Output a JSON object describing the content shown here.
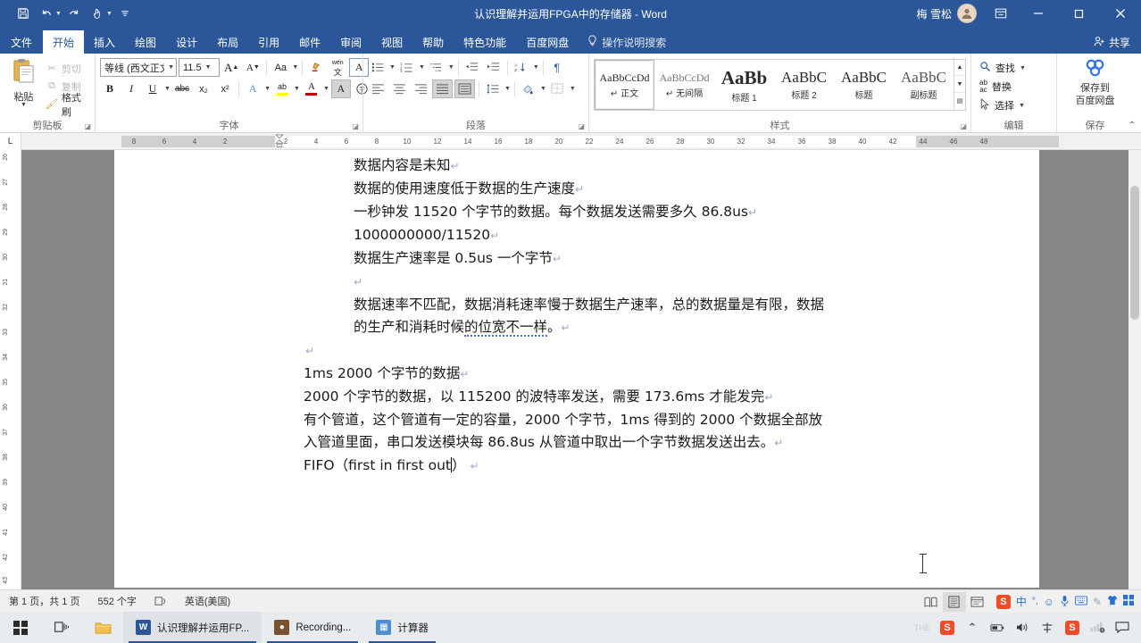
{
  "titlebar": {
    "document_title": "认识理解并运用FPGA中的存储器  -  Word",
    "quick_access": [
      {
        "name": "save",
        "glyph": "ὋE"
      },
      {
        "name": "undo",
        "glyph": "↶"
      },
      {
        "name": "redo",
        "glyph": "↻"
      },
      {
        "name": "touch-mode",
        "glyph": "✋"
      },
      {
        "name": "customize",
        "glyph": "≡"
      }
    ],
    "account_name": "梅 雪松",
    "avatar_glyph": "☺",
    "ribbon_display_options": "❐",
    "minimize": "—",
    "restore": "❐",
    "close": "✕"
  },
  "tabs": [
    {
      "label": "文件",
      "active": false
    },
    {
      "label": "开始",
      "active": true
    },
    {
      "label": "插入",
      "active": false
    },
    {
      "label": "绘图",
      "active": false
    },
    {
      "label": "设计",
      "active": false
    },
    {
      "label": "布局",
      "active": false
    },
    {
      "label": "引用",
      "active": false
    },
    {
      "label": "邮件",
      "active": false
    },
    {
      "label": "审阅",
      "active": false
    },
    {
      "label": "视图",
      "active": false
    },
    {
      "label": "帮助",
      "active": false
    },
    {
      "label": "特色功能",
      "active": false
    },
    {
      "label": "百度网盘",
      "active": false
    }
  ],
  "tell_me": "操作说明搜索",
  "share_label": "共享",
  "ribbon": {
    "clipboard": {
      "group_label": "剪贴板",
      "paste_label": "粘贴",
      "cut_label": "剪切",
      "copy_label": "复制",
      "format_painter_label": "格式刷"
    },
    "font": {
      "group_label": "字体",
      "font_name": "等线 (西文正文",
      "font_size": "11.5",
      "grow_font": "A",
      "shrink_font": "A",
      "change_case": "Aa",
      "clear_formatting": "✂",
      "phonetic_guide": "文",
      "character_border": "A",
      "bold": "B",
      "italic": "I",
      "underline": "U",
      "strikethrough": "abc",
      "subscript": "x₂",
      "superscript": "x²",
      "text_effects": "A",
      "highlight": "ab",
      "font_color": "A",
      "char_shading": "A",
      "enclose_char": "字"
    },
    "paragraph": {
      "group_label": "段落",
      "bullets": "☰",
      "numbering": "☰",
      "multilevel": "☰",
      "decrease_indent": "←",
      "increase_indent": "→",
      "sort": "AZ",
      "show_marks": "¶",
      "align_left": "≡",
      "align_center": "≡",
      "align_right": "≡",
      "justify": "≡",
      "distributed": "≡",
      "line_spacing": "↕",
      "shading": "■",
      "borders": "▦"
    },
    "styles": {
      "group_label": "样式",
      "items": [
        {
          "preview": "AaBbCcDd",
          "name": "正文",
          "selected": true,
          "kind": "normal"
        },
        {
          "preview": "AaBbCcDd",
          "name": "无间隔",
          "selected": false,
          "kind": "normal"
        },
        {
          "preview": "AaBb",
          "name": "标题 1",
          "selected": false,
          "kind": "h1"
        },
        {
          "preview": "AaBbC",
          "name": "标题 2",
          "selected": false,
          "kind": "h2"
        },
        {
          "preview": "AaBbC",
          "name": "标题",
          "selected": false,
          "kind": "t"
        },
        {
          "preview": "AaBbC",
          "name": "副标题",
          "selected": false,
          "kind": "st"
        }
      ]
    },
    "editing": {
      "group_label": "编辑",
      "find_label": "查找",
      "replace_label": "替换",
      "select_label": "选择"
    },
    "save_group": {
      "group_label": "保存",
      "baidu_label_line1": "保存到",
      "baidu_label_line2": "百度网盘"
    }
  },
  "ruler": {
    "tab_selector": "L",
    "h_marks": [
      "8",
      "6",
      "4",
      "2",
      "",
      "2",
      "4",
      "6",
      "8",
      "10",
      "12",
      "14",
      "16",
      "18",
      "20",
      "22",
      "24",
      "26",
      "28",
      "30",
      "32",
      "34",
      "36",
      "38",
      "40",
      "42",
      "44",
      "46",
      "48"
    ],
    "v_marks": [
      "26",
      "27",
      "28",
      "29",
      "30",
      "31",
      "32",
      "33",
      "34",
      "35",
      "36",
      "37",
      "38",
      "39",
      "40",
      "41",
      "42",
      "43"
    ]
  },
  "document": {
    "lines": [
      {
        "text": "数据内容是未知",
        "indent": true,
        "pilcrow": true
      },
      {
        "text": "数据的使用速度低于数据的生产速度",
        "indent": true,
        "pilcrow": true
      },
      {
        "text": "一秒钟发 11520 个字节的数据。每个数据发送需要多久 86.8us",
        "indent": true,
        "pilcrow": true
      },
      {
        "text": "1000000000/11520",
        "indent": true,
        "pilcrow": true
      },
      {
        "text": "数据生产速率是 0.5us 一个字节",
        "indent": true,
        "pilcrow": true
      },
      {
        "text": "",
        "indent": true,
        "pilcrow": true
      },
      {
        "text": "数据速率不匹配，数据消耗速率慢于数据生产速率，总的数据量是有限，数据",
        "indent": true,
        "pilcrow": false
      },
      {
        "text": "的生产和消耗时候的位宽不一样。",
        "indent": true,
        "pilcrow": true,
        "squiggle_from": "的位宽不一样"
      },
      {
        "text": "",
        "indent": false,
        "pilcrow": true
      },
      {
        "text": "1ms 2000 个字节的数据",
        "indent": false,
        "pilcrow": true
      },
      {
        "text": "2000 个字节的数据，以 115200 的波特率发送，需要 173.6ms 才能发完",
        "indent": false,
        "pilcrow": true
      },
      {
        "text": "有个管道，这个管道有一定的容量，2000 个字节，1ms 得到的 2000 个数据全部放",
        "indent": false,
        "pilcrow": false
      },
      {
        "text": "入管道里面，串口发送模块每 86.8us 从管道中取出一个字节数据发送出去。",
        "indent": false,
        "pilcrow": true
      },
      {
        "text": "FIFO（first in first out）",
        "indent": false,
        "pilcrow": true,
        "caret_after": "FIFO（first in first out"
      }
    ]
  },
  "statusbar": {
    "page_info": "第 1 页，共 1 页",
    "word_count": "552 个字",
    "proofing_icon": "✓",
    "language": "英语(美国)",
    "views": [
      {
        "name": "read-mode",
        "glyph": "Ὅ6",
        "active": false
      },
      {
        "name": "print-layout",
        "glyph": "▤",
        "active": true
      },
      {
        "name": "web-layout",
        "glyph": "▦",
        "active": false
      }
    ],
    "ime": {
      "logo": "S",
      "mode": "中",
      "punctuation": "°,",
      "emoji": "☺",
      "voice": "Ἲ4",
      "keyboard": "⌨",
      "handwriting": "✍",
      "skin": "ὅ5",
      "toolbox": "⊞"
    }
  },
  "taskbar": {
    "start": "⊞",
    "task_view": "❑",
    "file_explorer": "Ὄ1",
    "items": [
      {
        "label": "认识理解并运用FP...",
        "icon": "W",
        "icon_kind": "ico-word",
        "active": true
      },
      {
        "label": "Recording...",
        "icon": "R",
        "icon_kind": "ico-rec",
        "active": false
      },
      {
        "label": "计算器",
        "icon": "▦",
        "icon_kind": "ico-calc",
        "active": false
      }
    ],
    "tray": [
      {
        "name": "sogou-pinyin-tray",
        "glyph": "S"
      },
      {
        "name": "show-hidden-icons",
        "glyph": "⌃"
      },
      {
        "name": "battery",
        "glyph": "ὐB"
      },
      {
        "name": "volume",
        "glyph": "ὐA"
      },
      {
        "name": "ime-indicator",
        "glyph": "中"
      },
      {
        "name": "sogou-input",
        "glyph": "S"
      },
      {
        "name": "network",
        "glyph": "὏6"
      },
      {
        "name": "notifications",
        "glyph": "὞8"
      }
    ]
  },
  "colors": {
    "word_blue": "#2b579a",
    "doc_background": "#868686",
    "accent_red": "#c00000",
    "baidu_blue": "#3471f5"
  }
}
